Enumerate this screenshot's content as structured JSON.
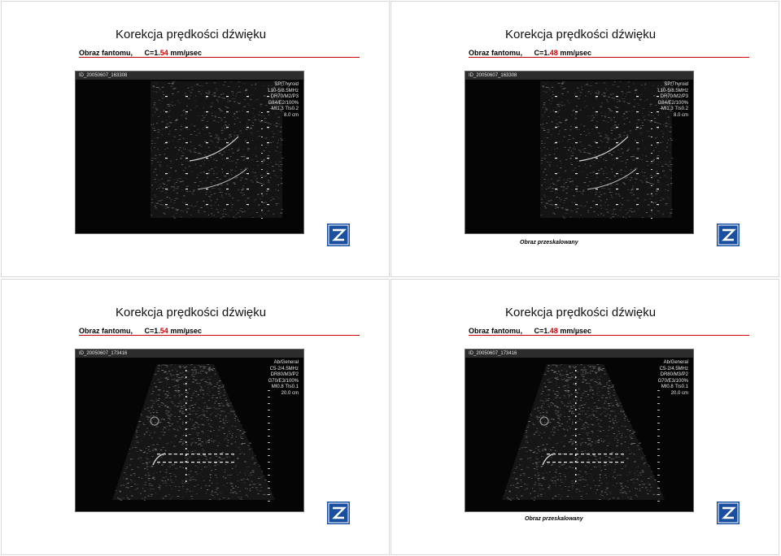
{
  "slides": [
    {
      "title": "Korekcja prędkości dźwięku",
      "phantom_label": "Obraz fantomu,",
      "c_label": "C=1.",
      "c_value": "54",
      "unit": " mm/µsec",
      "scan_id": "ID_20050607_163308",
      "params": [
        "SP/Thyroid",
        "L10-5/8.5MHz",
        "DR70/M2/P3",
        "G84/E2/100%",
        "MI1.3  TIs0.2",
        "8.0 cm"
      ],
      "note": ""
    },
    {
      "title": "Korekcja prędkości dźwięku",
      "phantom_label": "Obraz fantomu,",
      "c_label": "C=1.",
      "c_value": "48",
      "unit": " mm/µsec",
      "scan_id": "ID_20050607_163308",
      "params": [
        "SP/Thyroid",
        "L10-5/8.5MHz",
        "DR70/M2/P3",
        "G84/E2/100%",
        "MI1.3  TIs0.2",
        "8.0 cm"
      ],
      "note": "Obraz przeskalowany"
    },
    {
      "title": "Korekcja prędkości dźwięku",
      "phantom_label": "Obraz fantomu,",
      "c_label": "C=1.",
      "c_value": "54",
      "unit": " mm/µsec",
      "scan_id": "ID_20050607_173416",
      "params": [
        "Ab/General",
        "C5-2/4.5MHz",
        "DR80/M3/P2",
        "G70/E3/100%",
        "MI0.8  TIs0.1",
        "20.0 cm"
      ],
      "note": ""
    },
    {
      "title": "Korekcja prędkości dźwięku",
      "phantom_label": "Obraz fantomu,",
      "c_label": "C=1.",
      "c_value": "48",
      "unit": " mm/µsec",
      "scan_id": "ID_20050607_173416",
      "params": [
        "Ab/General",
        "C5-2/4.5MHz",
        "DR80/M3/P2",
        "G70/E3/100%",
        "MI0.8  TIs0.1",
        "20.0 cm"
      ],
      "note": "Obraz przeskalowany"
    }
  ],
  "colors": {
    "accent": "#cc0000",
    "logo_blue": "#1a4fa0"
  },
  "icons": {
    "logo": "zeus-z-logo"
  }
}
